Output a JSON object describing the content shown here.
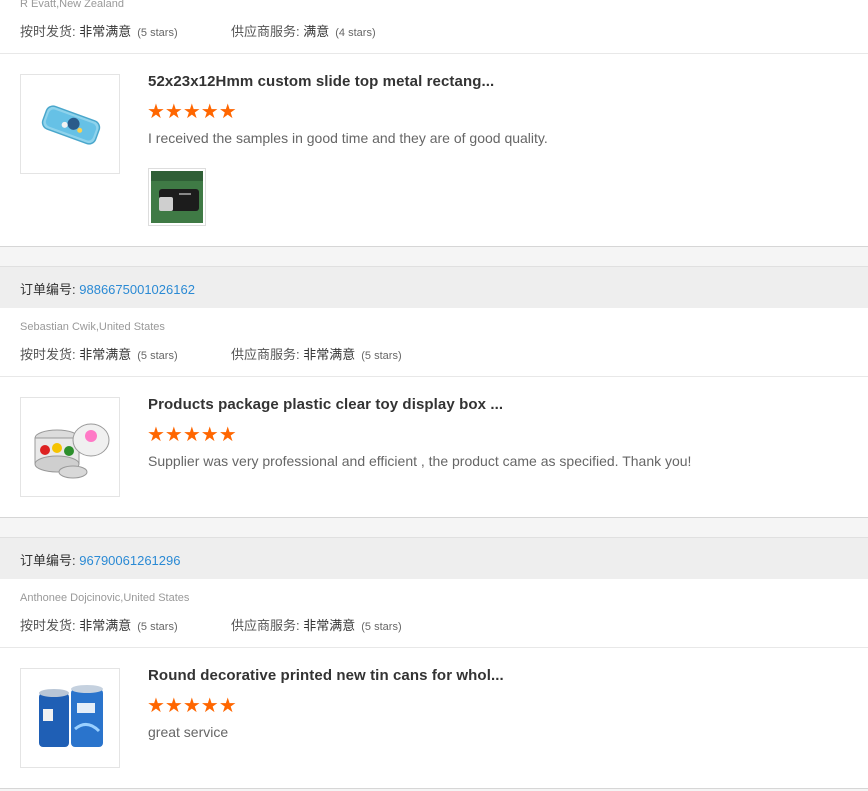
{
  "reviews": [
    {
      "order_label": "",
      "order_number": "",
      "buyer": "R Evatt,New Zealand",
      "delivery_label": "按时发货:",
      "delivery_value": "非常满意",
      "delivery_stars": "(5 stars)",
      "service_label": "供应商服务:",
      "service_value": "满意",
      "service_stars": "(4 stars)",
      "product_name": "52x23x12Hmm custom slide top metal rectang...",
      "rating": 5,
      "stars_text": "★★★★★",
      "comment": "I received the samples in good time and they are of good quality.",
      "thumb_icon": "blue-mint-tin-image",
      "photo_icon": "black-tin-photo"
    },
    {
      "order_label": "订单编号:",
      "order_number": "9886675001026162",
      "buyer": "Sebastian Cwik,United States",
      "delivery_label": "按时发货:",
      "delivery_value": "非常满意",
      "delivery_stars": "(5 stars)",
      "service_label": "供应商服务:",
      "service_value": "非常满意",
      "service_stars": "(5 stars)",
      "product_name": "Products package plastic clear toy display box ...",
      "rating": 5,
      "stars_text": "★★★★★",
      "comment": "Supplier was very professional and efficient , the product came as specified. Thank you!",
      "thumb_icon": "paint-can-image"
    },
    {
      "order_label": "订单编号:",
      "order_number": "96790061261296",
      "buyer": "Anthonee Dojcinovic,United States",
      "delivery_label": "按时发货:",
      "delivery_value": "非常满意",
      "delivery_stars": "(5 stars)",
      "service_label": "供应商服务:",
      "service_value": "非常满意",
      "service_stars": "(5 stars)",
      "product_name": "Round decorative printed new tin cans for whol...",
      "rating": 5,
      "stars_text": "★★★★★",
      "comment": "great service",
      "thumb_icon": "blue-tin-cans-image"
    }
  ],
  "colors": {
    "accent_link": "#2b8ad4",
    "star": "#ff6600",
    "bar": "#eeeeee"
  }
}
